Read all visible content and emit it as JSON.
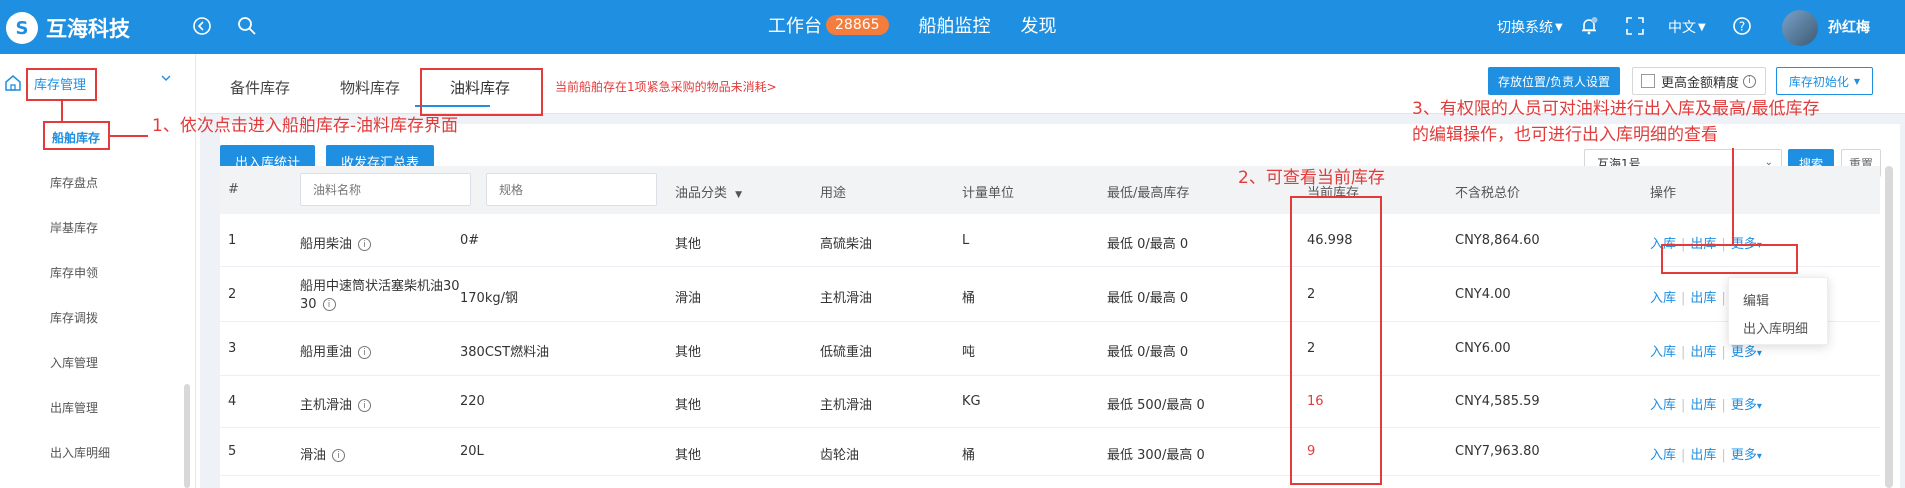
{
  "app": {
    "logo_text": "互海科技",
    "logo_glyph": "S"
  },
  "topbar": {
    "back_icon": "circle-back-icon",
    "search_icon": "search-icon",
    "nav": [
      {
        "label": "工作台",
        "badge": "28865"
      },
      {
        "label": "船舶监控"
      },
      {
        "label": "发现"
      }
    ],
    "switch_system": "切换系统",
    "language": "中文",
    "user_name": "孙红梅",
    "icons": [
      "bell-icon",
      "fullscreen-icon",
      "help-icon",
      "chevron-down-icon"
    ]
  },
  "sidebar": {
    "group_label": "库存管理",
    "items": [
      "船舶库存",
      "库存盘点",
      "岸基库存",
      "库存申领",
      "库存调拨",
      "入库管理",
      "出库管理",
      "出入库明细"
    ]
  },
  "tabs": [
    "备件库存",
    "物料库存",
    "油料库存"
  ],
  "active_tab": "油料库存",
  "notice": "当前船舶存在1项紧急采购的物品未消耗>",
  "toolbar": {
    "storage_setting": "存放位置/负责人设置",
    "higher_precision": "更高金额精度",
    "init": "库存初始化",
    "stats": "出入库统计",
    "summary": "收发存汇总表",
    "ship_select": "互海1号",
    "search": "搜索",
    "reset": "重置"
  },
  "table": {
    "headers": [
      "#",
      "油品分类",
      "用途",
      "计量单位",
      "最低/最高库存",
      "当前库存",
      "不含税总价",
      "操作"
    ],
    "filter_placeholders": {
      "name": "油料名称",
      "spec": "规格"
    },
    "rows": [
      {
        "no": "1",
        "name": "船用柴油",
        "spec": "0#",
        "cat": "其他",
        "use": "高硫柴油",
        "unit": "L",
        "minmax": "最低 0/最高 0",
        "stock": "46.998",
        "stock_alert": false,
        "price": "CNY8,864.60"
      },
      {
        "no": "2",
        "name": "船用中速筒状活塞柴机油30",
        "name2": "30",
        "spec": "170kg/钢",
        "cat": "滑油",
        "use": "主机滑油",
        "unit": "桶",
        "minmax": "最低 0/最高 0",
        "stock": "2",
        "stock_alert": false,
        "price": "CNY4.00"
      },
      {
        "no": "3",
        "name": "船用重油",
        "spec": "380CST燃料油",
        "cat": "其他",
        "use": "低硫重油",
        "unit": "吨",
        "minmax": "最低 0/最高 0",
        "stock": "2",
        "stock_alert": false,
        "price": "CNY6.00"
      },
      {
        "no": "4",
        "name": "主机滑油",
        "spec": "220",
        "cat": "其他",
        "use": "主机滑油",
        "unit": "KG",
        "minmax": "最低 500/最高 0",
        "stock": "16",
        "stock_alert": true,
        "price": "CNY4,585.59"
      },
      {
        "no": "5",
        "name": "滑油",
        "spec": "20L",
        "cat": "其他",
        "use": "齿轮油",
        "unit": "桶",
        "minmax": "最低 300/最高 0",
        "stock": "9",
        "stock_alert": true,
        "price": "CNY7,963.80"
      }
    ],
    "ops": {
      "in": "入库",
      "out": "出库",
      "more": "更多"
    },
    "more_menu": [
      "编辑",
      "出入库明细"
    ]
  },
  "annotations": {
    "a1": "1、依次点击进入船舶库存-油料库存界面",
    "a2": "2、可查看当前库存",
    "a3_line1": "3、有权限的人员可对油料进行出入库及最高/最低库存",
    "a3_line2": "的编辑操作，也可进行出入库明细的查看"
  },
  "colors": {
    "primary": "#1e8fe1",
    "alert": "#e23b3b",
    "badge": "#f47c3c"
  }
}
